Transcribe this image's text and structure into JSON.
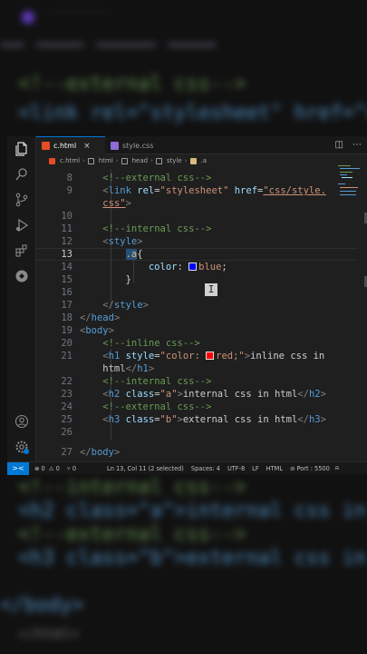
{
  "background": {
    "top_lines": [
      "<!--external css-->",
      "<link rel=\"stylesheet\" href=\"css/"
    ],
    "bottom_lines": [
      "<!--internal css-->",
      "<h2 class=\"a\">internal css in h",
      "<!--external css-->",
      "<h3 class=\"b\">external css in h",
      "</body>",
      "</html>"
    ]
  },
  "tabs": [
    {
      "label": "c.html",
      "icon": "html-file-icon",
      "active": true,
      "close": "×"
    },
    {
      "label": "style.css",
      "icon": "css-file-icon",
      "active": false
    }
  ],
  "breadcrumb": [
    "c.html",
    "html",
    "head",
    "style",
    ".a"
  ],
  "code": {
    "line_numbers": [
      "8",
      "9",
      "",
      "10",
      "11",
      "12",
      "13",
      "14",
      "15",
      "16",
      "17",
      "18",
      "19",
      "20",
      "21",
      "",
      "22",
      "23",
      "24",
      "25",
      "26",
      "27"
    ],
    "current_line": "13",
    "color_values": {
      "blue": "#0000ff",
      "red": "#ff0000"
    }
  },
  "status": {
    "remote_icon": "><",
    "errors": "0",
    "warnings": "0",
    "ports_label": "0",
    "position": "Ln 13, Col 11 (2 selected)",
    "spaces": "Spaces: 4",
    "encoding": "UTF-8",
    "eol": "LF",
    "language": "HTML",
    "port": "Port : 5500"
  },
  "colors": {
    "accent": "#0078d4",
    "editor_bg": "#1f1f1f"
  }
}
